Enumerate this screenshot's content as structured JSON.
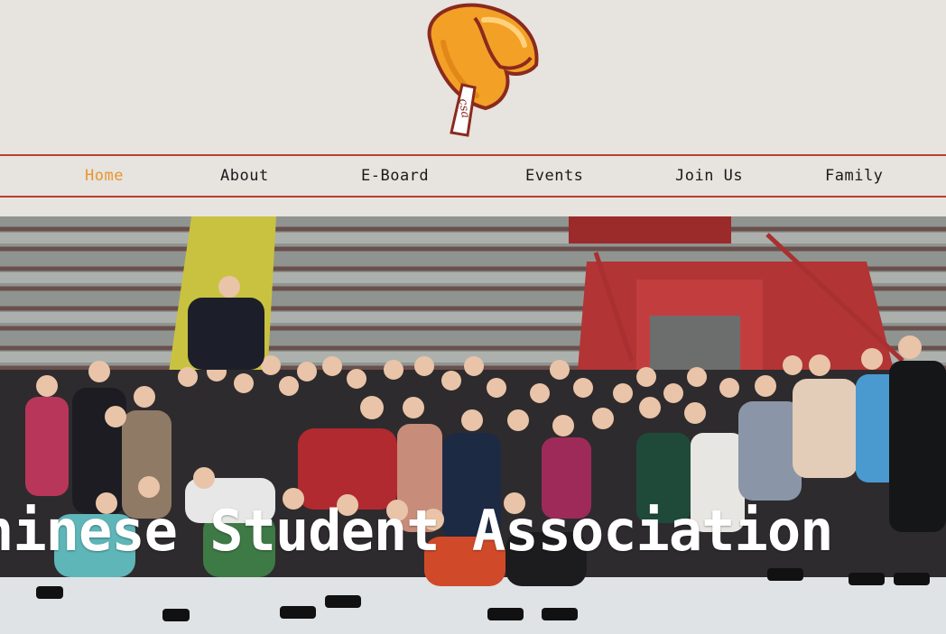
{
  "colors": {
    "background": "#e7e3df",
    "nav_border": "#b8412d",
    "nav_active": "#e8962c",
    "nav_text": "#1a1a1a",
    "logo_cookie": "#f3a027",
    "logo_outline": "#8a2a1e"
  },
  "logo": {
    "icon": "fortune-cookie-icon",
    "tag_text": "csa"
  },
  "nav": {
    "items": [
      {
        "label": "Home",
        "active": true
      },
      {
        "label": "About",
        "active": false
      },
      {
        "label": "E-Board",
        "active": false
      },
      {
        "label": "Events",
        "active": false
      },
      {
        "label": "Join Us",
        "active": false
      },
      {
        "label": "Family",
        "active": false
      }
    ]
  },
  "hero": {
    "image": "group-photo-ice-rink",
    "title": "hinese Student Association"
  }
}
